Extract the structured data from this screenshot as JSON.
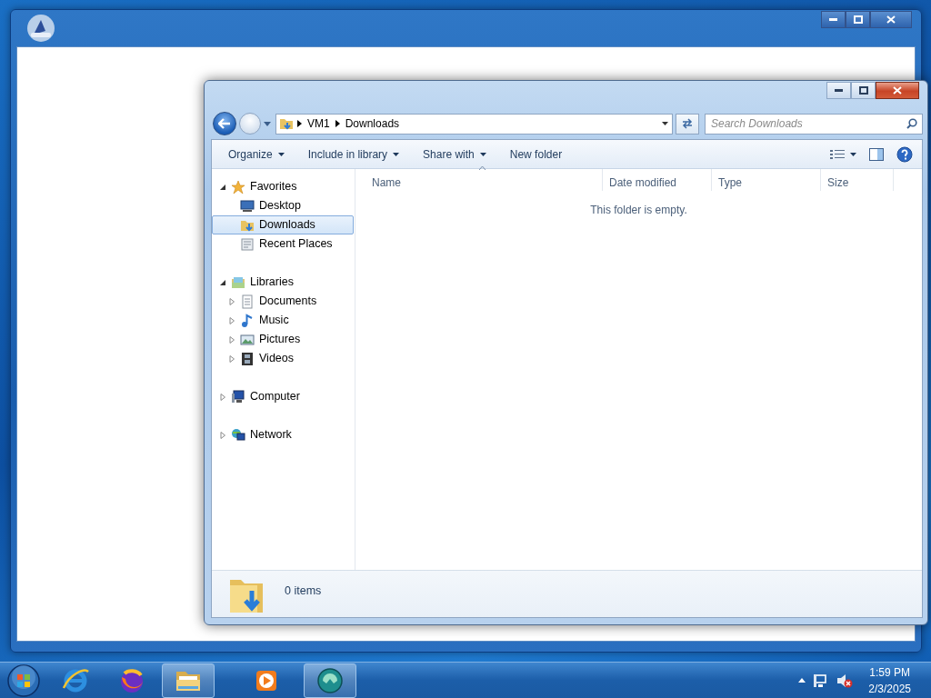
{
  "explorer": {
    "breadcrumb": [
      "VM1",
      "Downloads"
    ],
    "search": {
      "placeholder": "Search Downloads"
    },
    "commands": [
      {
        "label": "Organize",
        "menu": true
      },
      {
        "label": "Include in library",
        "menu": true
      },
      {
        "label": "Share with",
        "menu": true
      },
      {
        "label": "New folder",
        "menu": false
      }
    ],
    "nav_tree": [
      {
        "label": "Favorites",
        "expanded": true,
        "selected": false,
        "children": [
          {
            "label": "Desktop",
            "selected": false
          },
          {
            "label": "Downloads",
            "selected": true
          },
          {
            "label": "Recent Places",
            "selected": false
          }
        ]
      },
      {
        "label": "Libraries",
        "expanded": true,
        "selected": false,
        "children": [
          {
            "label": "Documents",
            "expanded": false,
            "selected": false
          },
          {
            "label": "Music",
            "expanded": false,
            "selected": false
          },
          {
            "label": "Pictures",
            "expanded": false,
            "selected": false
          },
          {
            "label": "Videos",
            "expanded": false,
            "selected": false
          }
        ]
      },
      {
        "label": "Computer",
        "expanded": false,
        "selected": false
      },
      {
        "label": "Network",
        "expanded": false,
        "selected": false
      }
    ],
    "columns": [
      {
        "label": "Name",
        "sorted": true
      },
      {
        "label": "Date modified",
        "sorted": false
      },
      {
        "label": "Type",
        "sorted": false
      },
      {
        "label": "Size",
        "sorted": false
      }
    ],
    "empty_message": "This folder is empty.",
    "status": "0 items"
  },
  "taskbar": {
    "apps": [
      {
        "running": false
      },
      {
        "running": false
      },
      {
        "running": true
      },
      {
        "running": false
      },
      {
        "running": true
      }
    ],
    "time": "1:59 PM",
    "date": "2/3/2025"
  }
}
